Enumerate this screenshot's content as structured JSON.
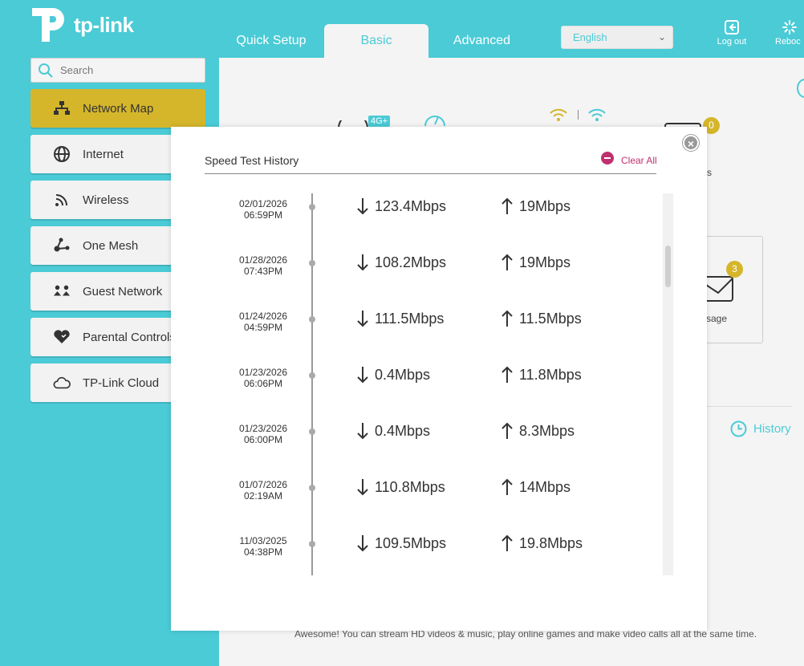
{
  "header": {
    "brand": "tp-link",
    "tabs": [
      {
        "label": "Quick Setup"
      },
      {
        "label": "Basic"
      },
      {
        "label": "Advanced"
      }
    ],
    "language": "English",
    "logout_label": "Log out",
    "reboot_label": "Reboc"
  },
  "sidebar": {
    "search_placeholder": "Search",
    "items": [
      {
        "label": "Network Map",
        "icon": "network-map-icon"
      },
      {
        "label": "Internet",
        "icon": "globe-icon"
      },
      {
        "label": "Wireless",
        "icon": "wireless-icon"
      },
      {
        "label": "One Mesh",
        "icon": "mesh-icon"
      },
      {
        "label": "Guest Network",
        "icon": "guest-icon"
      },
      {
        "label": "Parental Controls",
        "icon": "heart-icon"
      },
      {
        "label": "TP-Link Cloud",
        "icon": "cloud-icon"
      }
    ]
  },
  "background": {
    "badge_top": "0",
    "badge_card": "3",
    "card_label": "sage",
    "history_label": "History",
    "bottom_text": "Awesome! You can stream HD videos & music, play online games and make video calls all at the same time."
  },
  "modal": {
    "title": "Speed Test History",
    "clear_all": "Clear All",
    "close": "×",
    "rows": [
      {
        "date": "02/01/2026",
        "time": "06:59PM",
        "download": "123.4Mbps",
        "upload": "19Mbps"
      },
      {
        "date": "01/28/2026",
        "time": "07:43PM",
        "download": "108.2Mbps",
        "upload": "19Mbps"
      },
      {
        "date": "01/24/2026",
        "time": "04:59PM",
        "download": "111.5Mbps",
        "upload": "11.5Mbps"
      },
      {
        "date": "01/23/2026",
        "time": "06:06PM",
        "download": "0.4Mbps",
        "upload": "11.8Mbps"
      },
      {
        "date": "01/23/2026",
        "time": "06:00PM",
        "download": "0.4Mbps",
        "upload": "8.3Mbps"
      },
      {
        "date": "01/07/2026",
        "time": "02:19AM",
        "download": "110.8Mbps",
        "upload": "14Mbps"
      },
      {
        "date": "11/03/2025",
        "time": "04:38PM",
        "download": "109.5Mbps",
        "upload": "19.8Mbps"
      }
    ]
  },
  "colors": {
    "brand": "#4acbd6",
    "active_item": "#d5b62b",
    "danger": "#c0306e"
  }
}
